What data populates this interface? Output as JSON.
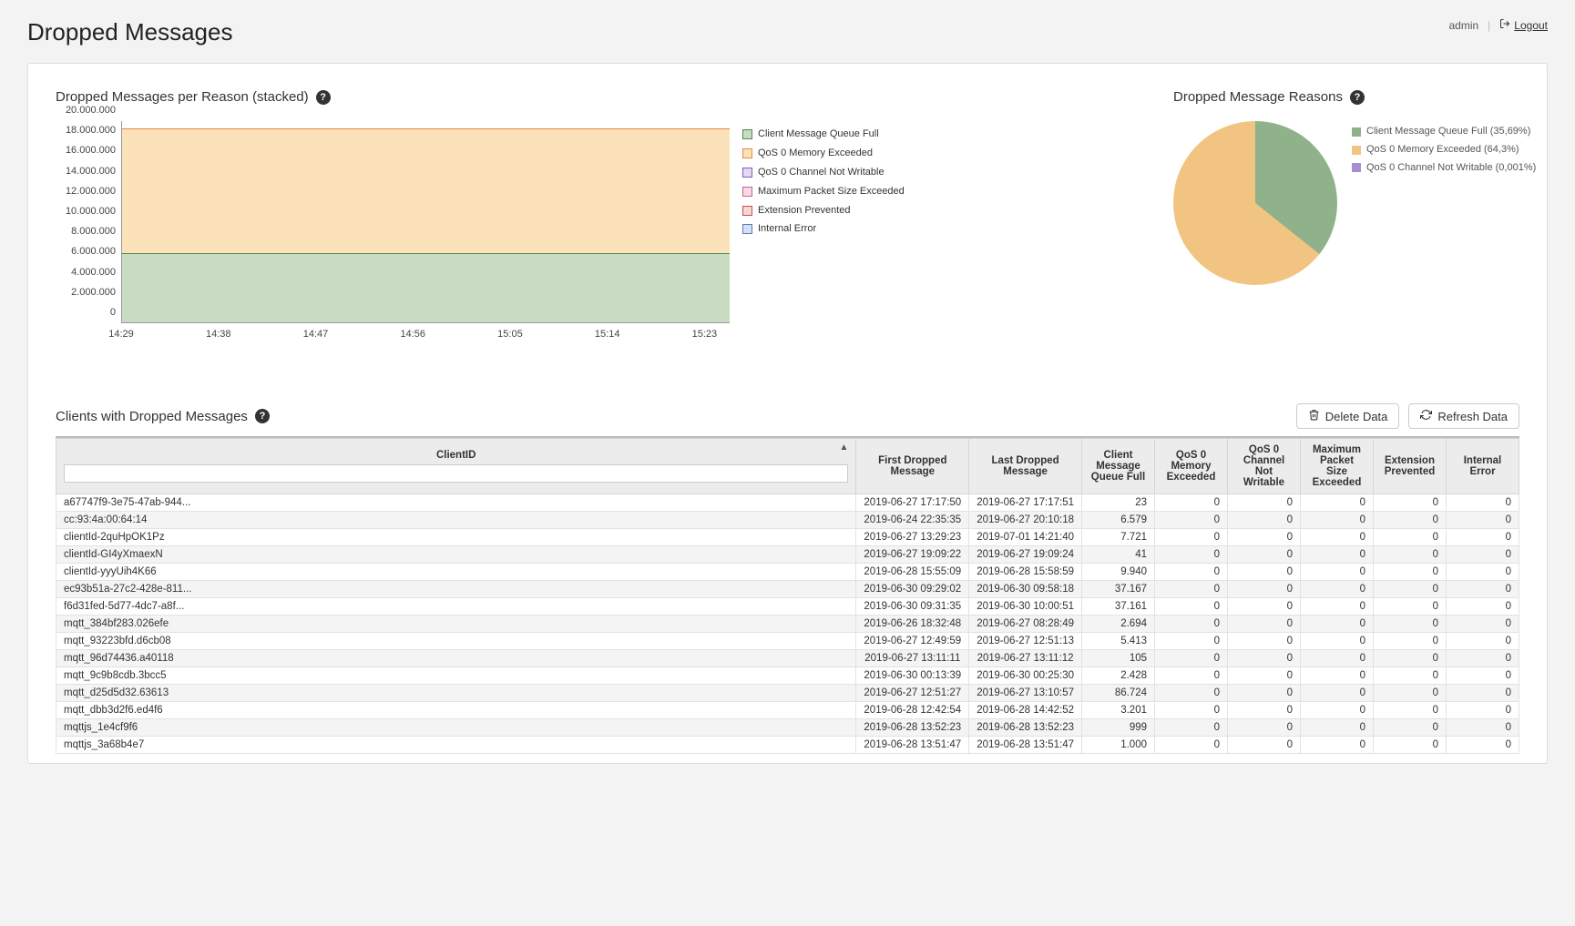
{
  "header": {
    "title": "Dropped Messages",
    "user": "admin",
    "logout": "Logout"
  },
  "stacked": {
    "title": "Dropped Messages per Reason (stacked)",
    "legend": [
      "Client Message Queue Full",
      "QoS 0 Memory Exceeded",
      "QoS 0 Channel Not Writable",
      "Maximum Packet Size Exceeded",
      "Extension Prevented",
      "Internal Error"
    ]
  },
  "pie": {
    "title": "Dropped Message Reasons",
    "legend": [
      "Client Message Queue Full (35,69%)",
      "QoS 0 Memory Exceeded (64,3%)",
      "QoS 0 Channel Not Writable (0,001%)"
    ]
  },
  "clients": {
    "title": "Clients with Dropped Messages",
    "delete_btn": "Delete Data",
    "refresh_btn": "Refresh Data",
    "columns": {
      "clientid": "ClientID",
      "first": "First Dropped Message",
      "last": "Last Dropped Message",
      "queue": "Client Message Queue Full",
      "mem": "QoS 0 Memory Exceeded",
      "chan": "QoS 0 Channel Not Writable",
      "pkt": "Maximum Packet Size Exceeded",
      "ext": "Extension Prevented",
      "ierr": "Internal Error"
    },
    "rows": [
      {
        "id": "a67747f9-3e75-47ab-944...",
        "first": "2019-06-27 17:17:50",
        "last": "2019-06-27 17:17:51",
        "queue": "23",
        "mem": "0",
        "chan": "0",
        "pkt": "0",
        "ext": "0",
        "ierr": "0"
      },
      {
        "id": "cc:93:4a:00:64:14",
        "first": "2019-06-24 22:35:35",
        "last": "2019-06-27 20:10:18",
        "queue": "6.579",
        "mem": "0",
        "chan": "0",
        "pkt": "0",
        "ext": "0",
        "ierr": "0"
      },
      {
        "id": "clientId-2quHpOK1Pz",
        "first": "2019-06-27 13:29:23",
        "last": "2019-07-01 14:21:40",
        "queue": "7.721",
        "mem": "0",
        "chan": "0",
        "pkt": "0",
        "ext": "0",
        "ierr": "0"
      },
      {
        "id": "clientId-GI4yXmaexN",
        "first": "2019-06-27 19:09:22",
        "last": "2019-06-27 19:09:24",
        "queue": "41",
        "mem": "0",
        "chan": "0",
        "pkt": "0",
        "ext": "0",
        "ierr": "0"
      },
      {
        "id": "clientId-yyyUih4K66",
        "first": "2019-06-28 15:55:09",
        "last": "2019-06-28 15:58:59",
        "queue": "9.940",
        "mem": "0",
        "chan": "0",
        "pkt": "0",
        "ext": "0",
        "ierr": "0"
      },
      {
        "id": "ec93b51a-27c2-428e-811...",
        "first": "2019-06-30 09:29:02",
        "last": "2019-06-30 09:58:18",
        "queue": "37.167",
        "mem": "0",
        "chan": "0",
        "pkt": "0",
        "ext": "0",
        "ierr": "0"
      },
      {
        "id": "f6d31fed-5d77-4dc7-a8f...",
        "first": "2019-06-30 09:31:35",
        "last": "2019-06-30 10:00:51",
        "queue": "37.161",
        "mem": "0",
        "chan": "0",
        "pkt": "0",
        "ext": "0",
        "ierr": "0"
      },
      {
        "id": "mqtt_384bf283.026efe",
        "first": "2019-06-26 18:32:48",
        "last": "2019-06-27 08:28:49",
        "queue": "2.694",
        "mem": "0",
        "chan": "0",
        "pkt": "0",
        "ext": "0",
        "ierr": "0"
      },
      {
        "id": "mqtt_93223bfd.d6cb08",
        "first": "2019-06-27 12:49:59",
        "last": "2019-06-27 12:51:13",
        "queue": "5.413",
        "mem": "0",
        "chan": "0",
        "pkt": "0",
        "ext": "0",
        "ierr": "0"
      },
      {
        "id": "mqtt_96d74436.a40118",
        "first": "2019-06-27 13:11:11",
        "last": "2019-06-27 13:11:12",
        "queue": "105",
        "mem": "0",
        "chan": "0",
        "pkt": "0",
        "ext": "0",
        "ierr": "0"
      },
      {
        "id": "mqtt_9c9b8cdb.3bcc5",
        "first": "2019-06-30 00:13:39",
        "last": "2019-06-30 00:25:30",
        "queue": "2.428",
        "mem": "0",
        "chan": "0",
        "pkt": "0",
        "ext": "0",
        "ierr": "0"
      },
      {
        "id": "mqtt_d25d5d32.63613",
        "first": "2019-06-27 12:51:27",
        "last": "2019-06-27 13:10:57",
        "queue": "86.724",
        "mem": "0",
        "chan": "0",
        "pkt": "0",
        "ext": "0",
        "ierr": "0"
      },
      {
        "id": "mqtt_dbb3d2f6.ed4f6",
        "first": "2019-06-28 12:42:54",
        "last": "2019-06-28 14:42:52",
        "queue": "3.201",
        "mem": "0",
        "chan": "0",
        "pkt": "0",
        "ext": "0",
        "ierr": "0"
      },
      {
        "id": "mqttjs_1e4cf9f6",
        "first": "2019-06-28 13:52:23",
        "last": "2019-06-28 13:52:23",
        "queue": "999",
        "mem": "0",
        "chan": "0",
        "pkt": "0",
        "ext": "0",
        "ierr": "0"
      },
      {
        "id": "mqttjs_3a68b4e7",
        "first": "2019-06-28 13:51:47",
        "last": "2019-06-28 13:51:47",
        "queue": "1.000",
        "mem": "0",
        "chan": "0",
        "pkt": "0",
        "ext": "0",
        "ierr": "0"
      }
    ]
  },
  "chart_data": [
    {
      "type": "area",
      "title": "Dropped Messages per Reason (stacked)",
      "x_ticks": [
        "14:29",
        "14:38",
        "14:47",
        "14:56",
        "15:05",
        "15:14",
        "15:23"
      ],
      "y_ticks": [
        "0",
        "2.000.000",
        "4.000.000",
        "6.000.000",
        "8.000.000",
        "10.000.000",
        "12.000.000",
        "14.000.000",
        "16.000.000",
        "18.000.000",
        "20.000.000"
      ],
      "ylim": [
        0,
        20000000
      ],
      "series": [
        {
          "name": "Client Message Queue Full",
          "approx_const_value": 6900000,
          "color": "#8fb28a"
        },
        {
          "name": "QoS 0 Memory Exceeded",
          "approx_const_value": 12400000,
          "color": "#f2c481"
        },
        {
          "name": "QoS 0 Channel Not Writable",
          "approx_const_value": 0,
          "color": "#a58fd1"
        },
        {
          "name": "Maximum Packet Size Exceeded",
          "approx_const_value": 0,
          "color": "#e3a2c0"
        },
        {
          "name": "Extension Prevented",
          "approx_const_value": 0,
          "color": "#d9857f"
        },
        {
          "name": "Internal Error",
          "approx_const_value": 0,
          "color": "#8aa2d9"
        }
      ],
      "stacked_total_approx": 19300000
    },
    {
      "type": "pie",
      "title": "Dropped Message Reasons",
      "slices": [
        {
          "name": "Client Message Queue Full",
          "percent": 35.69,
          "color": "#8fb28a"
        },
        {
          "name": "QoS 0 Memory Exceeded",
          "percent": 64.3,
          "color": "#f2c481"
        },
        {
          "name": "QoS 0 Channel Not Writable",
          "percent": 0.001,
          "color": "#a58fd1"
        }
      ]
    }
  ]
}
